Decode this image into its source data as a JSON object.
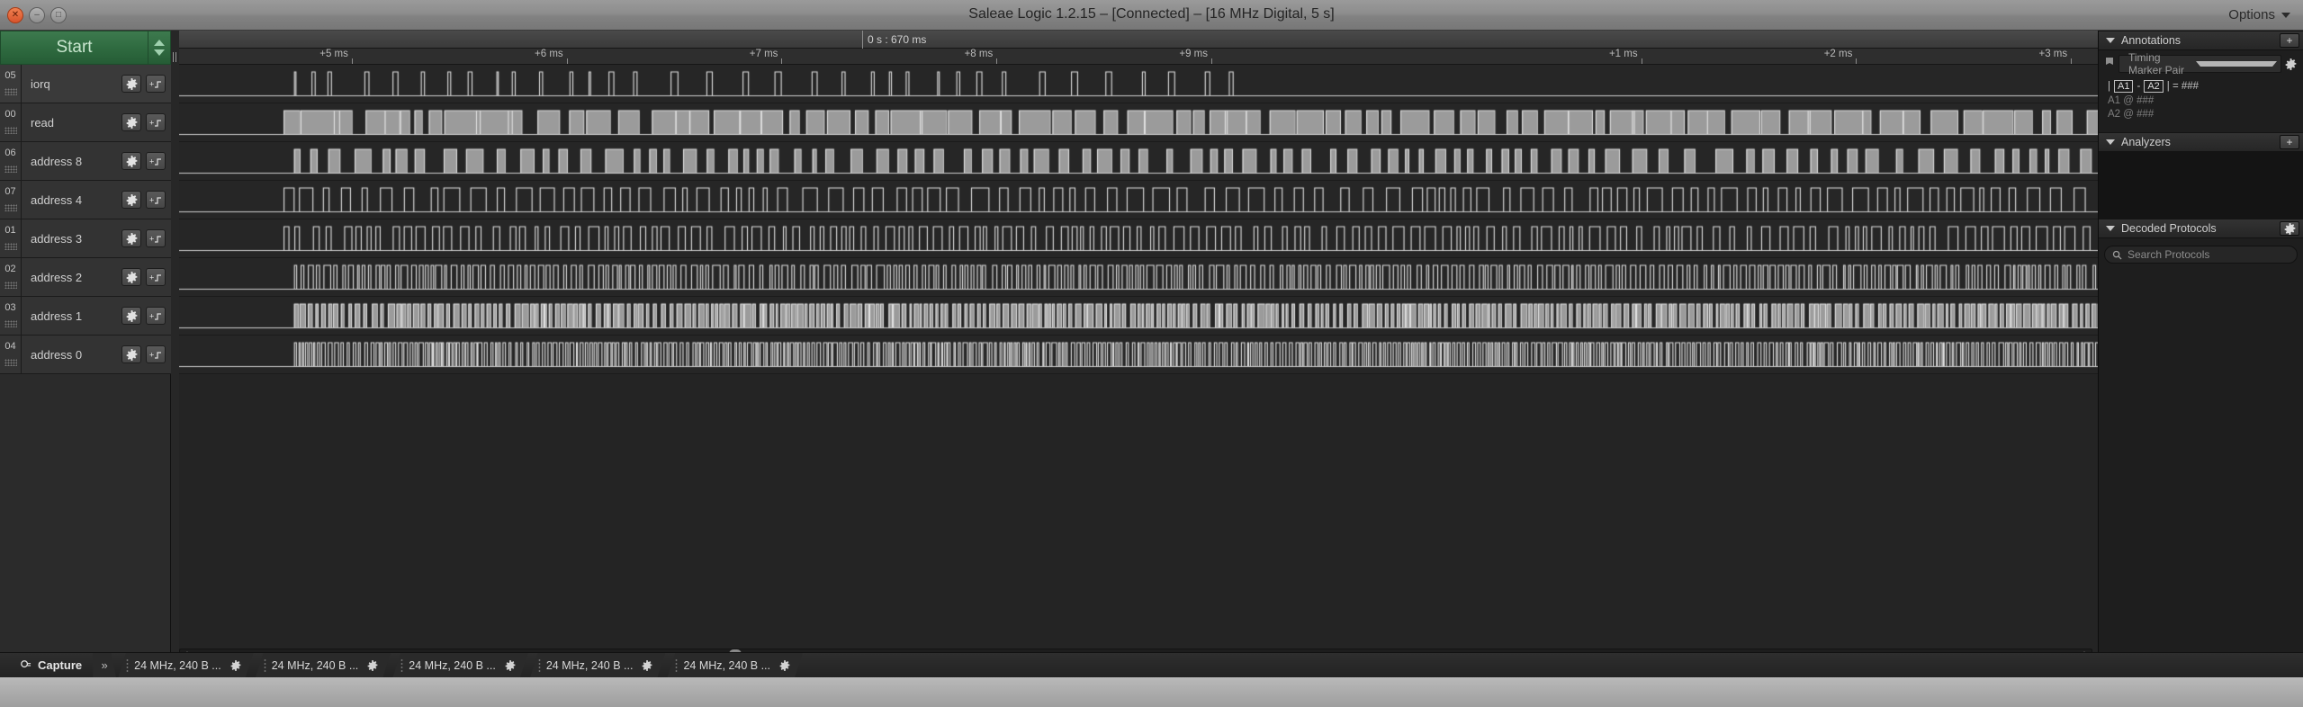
{
  "window": {
    "title": "Saleae Logic 1.2.15 – [Connected] – [16 MHz Digital, 5 s]",
    "options_label": "Options",
    "close_glyph": "✕",
    "minimize_glyph": "–",
    "maximize_glyph": "□"
  },
  "toolbar": {
    "start_label": "Start"
  },
  "channels": [
    {
      "num": "05",
      "name": "iorq",
      "color": "#6fbf2f"
    },
    {
      "num": "00",
      "name": "read",
      "color": "#3d3d3d"
    },
    {
      "num": "06",
      "name": "address 8",
      "color": "#2f6fd0"
    },
    {
      "num": "07",
      "name": "address 4",
      "color": "#b93fd6"
    },
    {
      "num": "01",
      "name": "address 3",
      "color": "#9a6b35"
    },
    {
      "num": "02",
      "name": "address 2",
      "color": "#d8301c"
    },
    {
      "num": "03",
      "name": "address 1",
      "color": "#e09020"
    },
    {
      "num": "04",
      "name": "address 0",
      "color": "#ddd630"
    }
  ],
  "timeline": {
    "overview_marker_label": "0 s : 670 ms",
    "overview_marker_pos_pct": 35.6,
    "ticks": [
      {
        "label": "+5 ms",
        "pos_pct": 9.0
      },
      {
        "label": "+6 ms",
        "pos_pct": 20.2
      },
      {
        "label": "+7 ms",
        "pos_pct": 31.4
      },
      {
        "label": "+8 ms",
        "pos_pct": 42.6
      },
      {
        "label": "+9 ms",
        "pos_pct": 53.8
      },
      {
        "label": "+1 ms",
        "pos_pct": 76.2
      },
      {
        "label": "+2 ms",
        "pos_pct": 87.4
      },
      {
        "label": "+3 ms",
        "pos_pct": 98.6
      }
    ],
    "scroll_arrow_left": "◀",
    "scroll_arrow_right": "▶",
    "scroll_thumb_pct": 28.5
  },
  "right_panel": {
    "annotations": {
      "title": "Annotations",
      "add_label": "+",
      "marker_pair_label": "Timing Marker Pair",
      "delta_prefix": "|",
      "a1_box": "A1",
      "dash": "-",
      "a2_box": "A2",
      "delta_suffix": "| = ###",
      "a1_line": "A1  @   ###",
      "a2_line": "A2  @   ###"
    },
    "analyzers": {
      "title": "Analyzers",
      "add_label": "+"
    },
    "decoded_protocols": {
      "title": "Decoded Protocols",
      "search_placeholder": "Search Protocols"
    }
  },
  "bottom_bar": {
    "capture_label": "Capture",
    "expand_glyph": "»",
    "devices": [
      {
        "label": "24 MHz, 240 B ..."
      },
      {
        "label": "24 MHz, 240 B ..."
      },
      {
        "label": "24 MHz, 240 B ..."
      },
      {
        "label": "24 MHz, 240 B ..."
      },
      {
        "label": "24 MHz, 240 B ..."
      }
    ]
  },
  "waveforms": {
    "note": "Digital logic capture; each channel drawn as square-wave pulse train",
    "traces": [
      {
        "channel": "iorq",
        "style": "narrow-low-pulses",
        "start_pct": 5.5,
        "end_pct": 50.8,
        "density": 0.012,
        "duty": 0.14,
        "filled": false
      },
      {
        "channel": "read",
        "style": "filled-high",
        "start_pct": 5.0,
        "end_pct": 100,
        "density": 0.011,
        "duty": 0.8,
        "filled": true
      },
      {
        "channel": "address 8",
        "style": "mixed-burst",
        "start_pct": 5.5,
        "end_pct": 100,
        "density": 0.01,
        "duty": 0.42,
        "filled": true
      },
      {
        "channel": "address 4",
        "style": "burst-then-slow",
        "start_pct": 5.0,
        "end_pct": 100,
        "density": 0.009,
        "duty": 0.48,
        "filled": false
      },
      {
        "channel": "address 3",
        "style": "dense-bursts",
        "start_pct": 5.0,
        "end_pct": 100,
        "density": 0.006,
        "duty": 0.45,
        "filled": false
      },
      {
        "channel": "address 2",
        "style": "very-dense",
        "start_pct": 5.5,
        "end_pct": 100,
        "density": 0.0035,
        "duty": 0.5,
        "filled": false
      },
      {
        "channel": "address 1",
        "style": "very-dense-filled",
        "start_pct": 5.5,
        "end_pct": 99,
        "density": 0.0028,
        "duty": 0.55,
        "filled": true
      },
      {
        "channel": "address 0",
        "style": "very-dense",
        "start_pct": 5.5,
        "end_pct": 99,
        "density": 0.0022,
        "duty": 0.5,
        "filled": false
      }
    ]
  }
}
